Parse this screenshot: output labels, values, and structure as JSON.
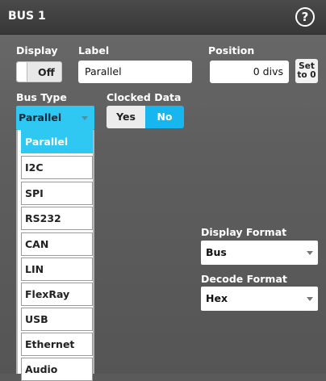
{
  "window": {
    "title": "BUS 1",
    "help_label": "?"
  },
  "display": {
    "label": "Display",
    "value": "Off"
  },
  "label_field": {
    "label": "Label",
    "value": "Parallel"
  },
  "position": {
    "label": "Position",
    "value": "0 divs",
    "set_button": "Set\nto 0",
    "set_line1": "Set",
    "set_line2": "to 0"
  },
  "bus_type": {
    "label": "Bus Type",
    "value": "Parallel",
    "options": [
      "Parallel",
      "I2C",
      "SPI",
      "RS232",
      "CAN",
      "LIN",
      "FlexRay",
      "USB",
      "Ethernet",
      "Audio"
    ],
    "selected_index": 0
  },
  "clocked_data": {
    "label": "Clocked Data",
    "yes": "Yes",
    "no": "No",
    "selected": "No"
  },
  "display_format": {
    "label": "Display Format",
    "value": "Bus"
  },
  "decode_format": {
    "label": "Decode Format",
    "value": "Hex"
  },
  "colors": {
    "accent": "#2ec8f2",
    "selected_toggle": "#18b6ef",
    "panel_bg": "#5e5e5e"
  }
}
